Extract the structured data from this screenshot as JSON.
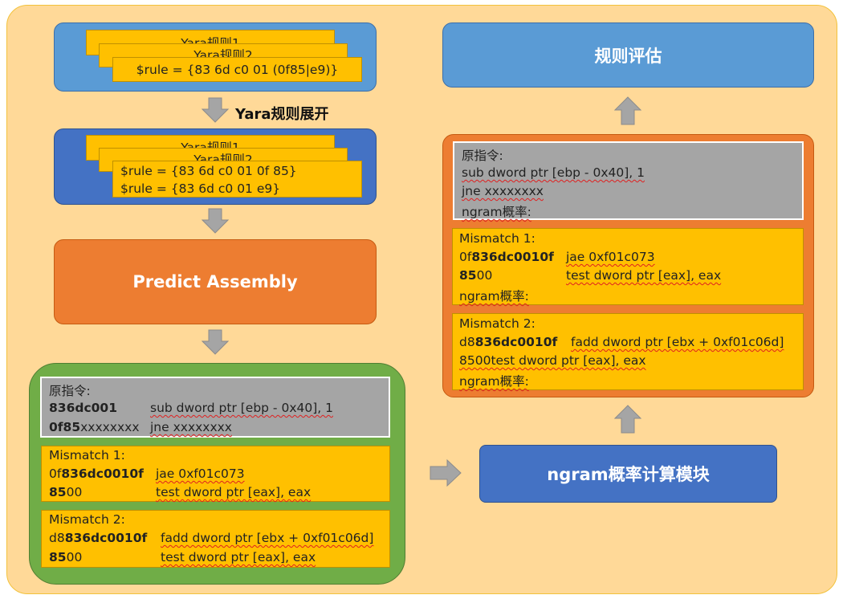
{
  "arrow_label": "Yara规则展开",
  "rules_box1": {
    "back1": "Yara规则1",
    "back2": "Yara规则2",
    "front": "$rule = {83 6d c0 01 (0f85|e9)}"
  },
  "rules_box2": {
    "back1": "Yara规则1",
    "back2": "Yara规则2",
    "front_line1": "$rule = {83 6d c0 01 0f 85}",
    "front_line2": "$rule = {83 6d c0 01 e9}"
  },
  "predict_box": "Predict Assembly",
  "left_panel": {
    "orig_title": "原指令:",
    "orig_l1_code": "836dc001",
    "orig_l1_asm": "sub dword ptr [ebp - 0x40], 1",
    "orig_l2_code_b": "0f85",
    "orig_l2_code_rest": "xxxxxxxx",
    "orig_l2_asm": "jne xxxxxxxx",
    "m1_title": "Mismatch 1:",
    "m1_l1_pre": "0f",
    "m1_l1_code": "836dc0010f",
    "m1_l1_asm": "jae 0xf01c073",
    "m1_l2_code": "85",
    "m1_l2_rest": "00",
    "m1_l2_asm": "test dword ptr [eax], eax",
    "m2_title": "Mismatch 2:",
    "m2_l1_pre": "d8",
    "m2_l1_code": "836dc0010f",
    "m2_l1_asm": "fadd dword ptr [ebx + 0xf01c06d]",
    "m2_l2_code": "85",
    "m2_l2_rest": "00",
    "m2_l2_asm": "test dword ptr [eax], eax"
  },
  "ngram_box": "ngram概率计算模块",
  "eval_box": "规则评估",
  "right_panel": {
    "orig_title": "原指令:",
    "orig_l1": "sub dword ptr [ebp - 0x40], 1",
    "orig_l2": "jne xxxxxxxx",
    "orig_l3": "ngram概率:",
    "m1_title": "Mismatch 1:",
    "m1_l1_pre": "0f",
    "m1_l1_code": "836dc0010f",
    "m1_l1_asm": "jae 0xf01c073",
    "m1_l2_code": "85",
    "m1_l2_rest": "00",
    "m1_l2_asm": "test dword ptr [eax], eax",
    "m1_l3": "ngram概率:",
    "m2_title": "Mismatch 2:",
    "m2_l1_pre": "d8",
    "m2_l1_code": "836dc0010f",
    "m2_l1_asm": "fadd dword ptr [ebx + 0xf01c06d]",
    "m2_l2": "8500test dword ptr [eax], eax",
    "m2_l3": "ngram概率:"
  },
  "colors": {
    "background": "#ffd998",
    "light_blue": "#5a9bd5",
    "dark_blue": "#4472c4",
    "orange": "#ed7d31",
    "green": "#70ad47",
    "yellow": "#ffc000",
    "gray": "#a5a5a5",
    "arrow": "#a5a5a5"
  }
}
